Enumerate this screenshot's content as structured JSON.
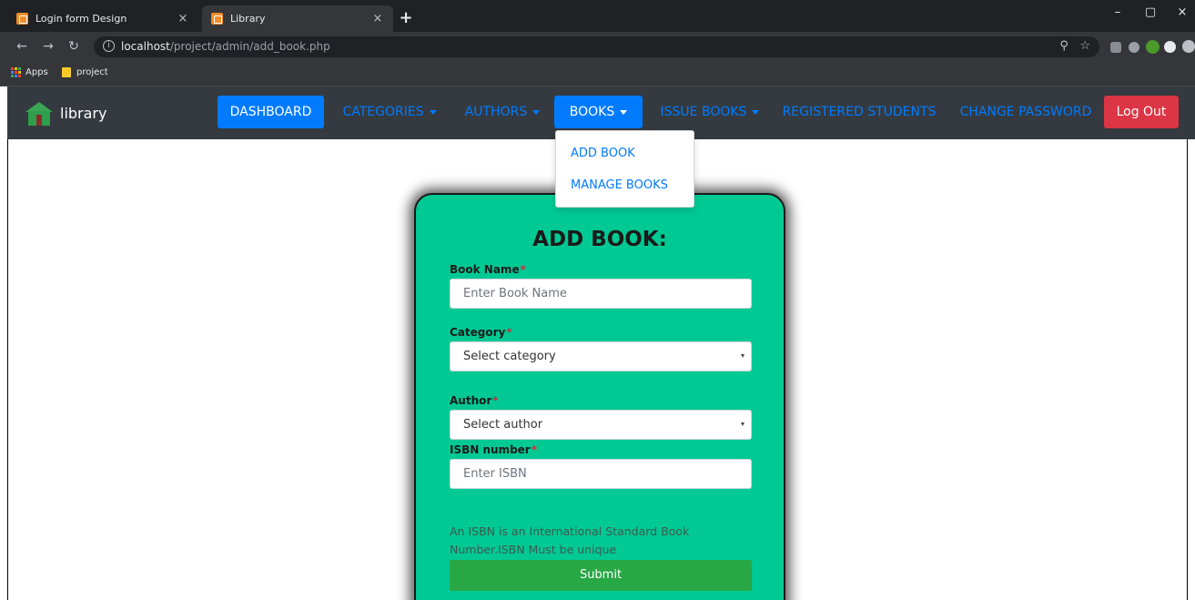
{
  "browser": {
    "tabs": [
      {
        "title": "Login form Design",
        "active": false
      },
      {
        "title": "Library",
        "active": true
      }
    ],
    "new_tab": "+",
    "url_host": "localhost",
    "url_path": "/project/admin/add_book.php",
    "bookmarks": [
      "Apps",
      "project"
    ]
  },
  "navbar": {
    "brand": "library",
    "items": [
      {
        "label": "DASHBOARD",
        "active": true,
        "dropdown": false
      },
      {
        "label": "CATEGORIES",
        "active": false,
        "dropdown": true
      },
      {
        "label": "AUTHORS",
        "active": false,
        "dropdown": true
      },
      {
        "label": "BOOKS",
        "active": true,
        "dropdown": true
      },
      {
        "label": "ISSUE BOOKS",
        "active": false,
        "dropdown": true
      },
      {
        "label": "REGISTERED STUDENTS",
        "active": false,
        "dropdown": false
      },
      {
        "label": "CHANGE PASSWORD",
        "active": false,
        "dropdown": false
      }
    ],
    "logout": "Log Out",
    "books_menu": [
      "ADD BOOK",
      "MANAGE BOOKS"
    ]
  },
  "form": {
    "title": "ADD BOOK:",
    "required_mark": "*",
    "book_name_label": "Book Name",
    "book_name_placeholder": "Enter Book Name",
    "category_label": "Category",
    "category_selected": "Select category",
    "author_label": "Author",
    "author_selected": "Select author",
    "isbn_label": "ISBN number",
    "isbn_placeholder": "Enter ISBN",
    "help_text": "An ISBN is an International Standard Book Number.ISBN Must be unique",
    "submit": "Submit"
  },
  "colors": {
    "primary": "#007bff",
    "danger": "#dc3545",
    "success": "#28a745",
    "card": "#00c994",
    "navbar": "#343a40"
  }
}
